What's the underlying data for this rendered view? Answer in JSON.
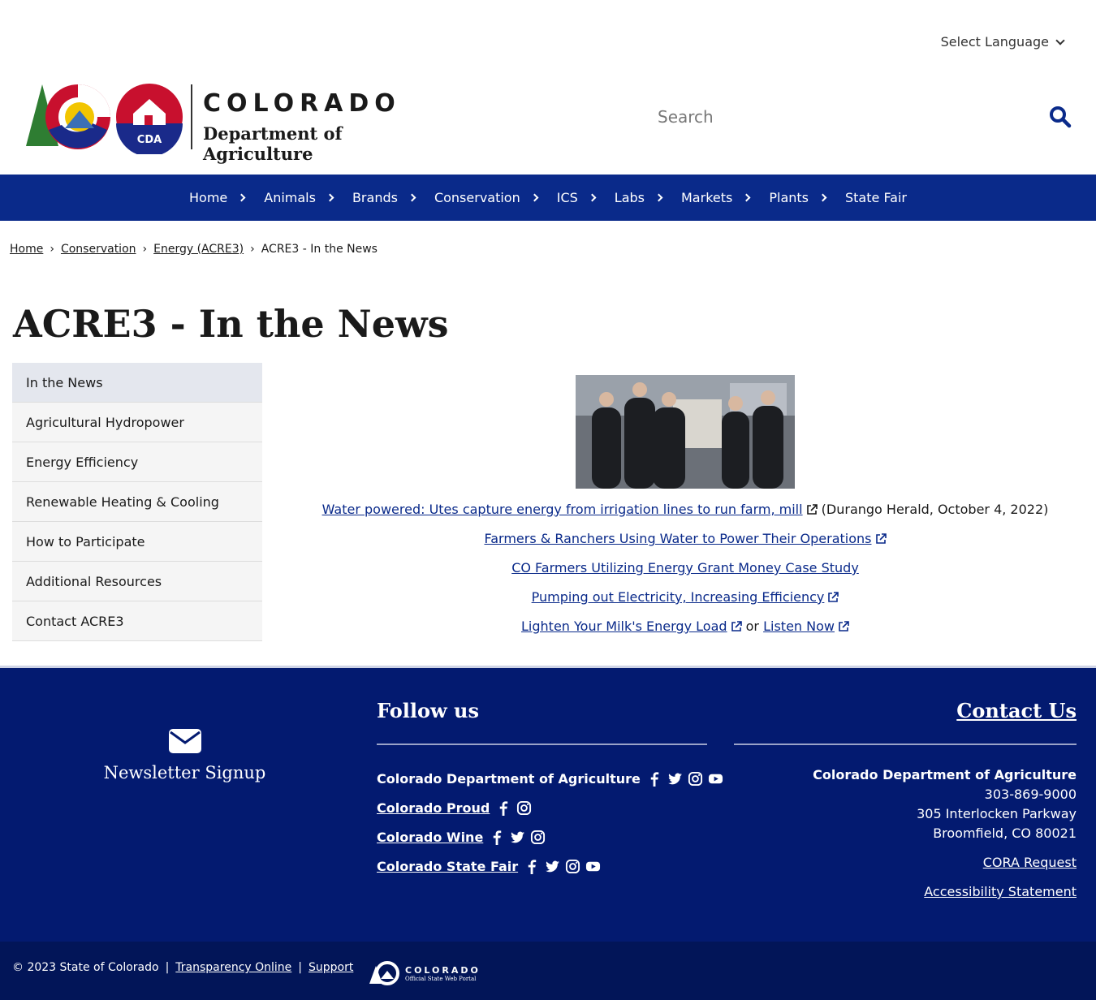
{
  "header": {
    "language_label": "Select Language",
    "logo_line1": "COLORADO",
    "logo_line2": "Department of Agriculture",
    "logo_badge": "CDA",
    "search_placeholder": "Search"
  },
  "nav": {
    "items": [
      "Home",
      "Animals",
      "Brands",
      "Conservation",
      "ICS",
      "Labs",
      "Markets",
      "Plants",
      "State Fair"
    ]
  },
  "breadcrumb": {
    "items": [
      "Home",
      "Conservation",
      "Energy (ACRE3)"
    ],
    "current": "ACRE3 - In the News"
  },
  "page_title": "ACRE3 - In the News",
  "sidebar": {
    "items": [
      {
        "label": "In the News",
        "active": true
      },
      {
        "label": "Agricultural Hydropower"
      },
      {
        "label": "Energy Efficiency"
      },
      {
        "label": "Renewable Heating & Cooling"
      },
      {
        "label": "How to Participate"
      },
      {
        "label": "Additional Resources"
      },
      {
        "label": "Contact ACRE3"
      }
    ]
  },
  "main": {
    "links": [
      {
        "text": "Water powered: Utes capture energy from irrigation lines to run farm, mill",
        "suffix": "(Durango Herald, October 4, 2022)"
      },
      {
        "text": "Farmers & Ranchers Using Water to Power Their Operations"
      },
      {
        "text": "CO Farmers Utilizing Energy Grant Money Case Study"
      },
      {
        "text": "Pumping out Electricity, Increasing Efficiency"
      },
      {
        "text": "Lighten Your Milk's Energy Load",
        "connector": "or",
        "text2": "Listen Now"
      }
    ]
  },
  "footer": {
    "newsletter": "Newsletter Signup",
    "follow_title": "Follow us",
    "follow": [
      {
        "label": "Colorado Department of Agriculture",
        "icons": [
          "facebook-icon",
          "twitter-icon",
          "instagram-icon",
          "youtube-icon"
        ]
      },
      {
        "label": "Colorado Proud",
        "icons": [
          "facebook-icon",
          "instagram-icon"
        ]
      },
      {
        "label": "Colorado Wine",
        "icons": [
          "facebook-icon",
          "twitter-icon",
          "instagram-icon"
        ]
      },
      {
        "label": "Colorado State Fair",
        "icons": [
          "facebook-icon",
          "twitter-icon",
          "instagram-icon",
          "youtube-icon"
        ]
      }
    ],
    "contact_title": "Contact Us",
    "contact": {
      "org": "Colorado Department of Agriculture",
      "phone": "303-869-9000",
      "address1": "305 Interlocken Parkway",
      "address2": "Broomfield, CO 80021",
      "cora": "CORA Request",
      "accessibility": "Accessibility Statement"
    },
    "bottom": {
      "copyright": "© 2023 State of Colorado",
      "sep": "|",
      "transparency": "Transparency Online",
      "support": "Support",
      "portal_line1": "COLORADO",
      "portal_line2": "Official State Web Portal"
    }
  },
  "colors": {
    "nav_bg": "#0a2a8a",
    "footer_bg": "#031a70",
    "link": "#0a2a8a",
    "brand_red": "#c8102e"
  }
}
